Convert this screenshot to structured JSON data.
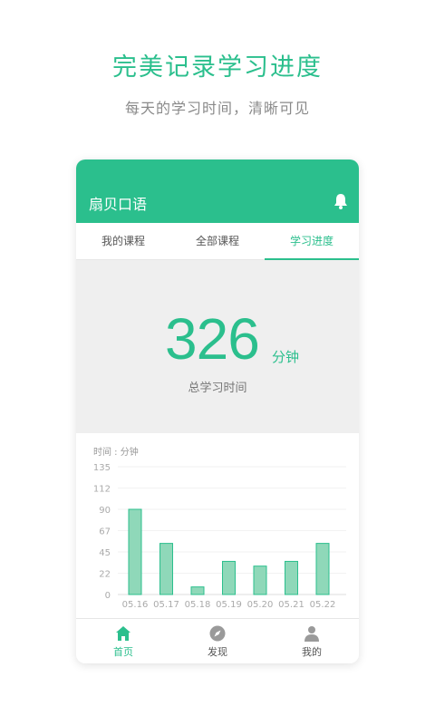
{
  "promo": {
    "headline": "完美记录学习进度",
    "subline": "每天的学习时间，清晰可见"
  },
  "app": {
    "title": "扇贝口语",
    "bell_icon": "bell-icon"
  },
  "tabs": [
    {
      "label": "我的课程",
      "active": false
    },
    {
      "label": "全部课程",
      "active": false
    },
    {
      "label": "学习进度",
      "active": true
    }
  ],
  "summary": {
    "total_value": "326",
    "unit": "分钟",
    "caption": "总学习时间"
  },
  "chart_data": {
    "type": "bar",
    "ylabel": "时间 : 分钟",
    "yticks": [
      "135",
      "112",
      "90",
      "67",
      "45",
      "22",
      "0"
    ],
    "ylim": [
      0,
      135
    ],
    "categories": [
      "05.16",
      "05.17",
      "05.18",
      "05.19",
      "05.20",
      "05.21",
      "05.22"
    ],
    "values": [
      90,
      54,
      8,
      35,
      30,
      35,
      54
    ],
    "grid": true
  },
  "colors": {
    "accent": "#2bbf8d",
    "bar_fill": "#8fd8b9",
    "bar_stroke": "#2bbf8d"
  },
  "bottom_nav": [
    {
      "label": "首页",
      "icon": "home-icon",
      "active": true
    },
    {
      "label": "发现",
      "icon": "compass-icon",
      "active": false
    },
    {
      "label": "我的",
      "icon": "person-icon",
      "active": false
    }
  ]
}
